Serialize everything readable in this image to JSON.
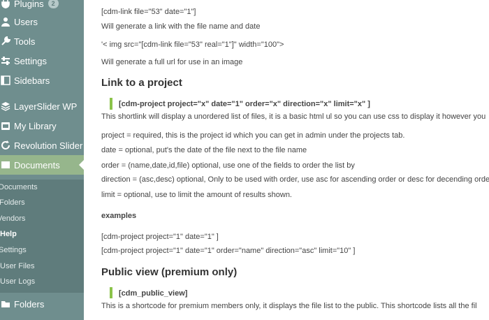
{
  "sidebar": {
    "menu": [
      {
        "label": "Plugins",
        "badge": "2",
        "icon": "plugin-icon"
      },
      {
        "label": "Users",
        "icon": "user-icon"
      },
      {
        "label": "Tools",
        "icon": "wrench-icon"
      },
      {
        "label": "Settings",
        "icon": "settings-icon"
      },
      {
        "label": "Sidebars",
        "icon": "sidebar-icon"
      },
      {
        "label": "LayerSlider WP",
        "icon": "layers-icon"
      },
      {
        "label": "My Library",
        "icon": "library-icon"
      },
      {
        "label": "Revolution Slider",
        "icon": "refresh-icon"
      },
      {
        "label": "Documents",
        "icon": "documents-icon"
      },
      {
        "label": "Folders",
        "icon": "folder-icon"
      }
    ],
    "submenu": [
      "Documents",
      "Folders",
      "Vendors",
      "Help",
      "Settings",
      "User Files",
      "User Logs"
    ],
    "colors": {
      "bg": "#6f8e8e",
      "active": "#96b68c",
      "submenu_bg": "#5f7c7c",
      "accent": "#8bc34a"
    }
  },
  "content": {
    "line1": "[cdm-link file=\"53\" date=\"1\"]",
    "line2": "Will generate a link with the file name and date",
    "line3": "'< img src=\"[cdm-link file=\"53\" real=\"1\"]\" width=\"100\">",
    "line4": "Will generate a full url for use in an image",
    "heading1": "Link to a project",
    "code1": "[cdm-project project=\"x\" date=\"1\" order=\"x\" direction=\"x\" limit=\"x\" ]",
    "desc1": "This shortlink will display a unordered list of files, it is a basic html ul so you can use css to display it however you",
    "param1": "project = required, this is the project id which you can get in admin under the projects tab.",
    "param2": "date = optional, put's the date of the file next to the file name",
    "param3": "order = (name,date,id,file) optional, use one of the fields to order the list by",
    "param4": "direction = (asc,desc) optional, Only to be used with order, use asc for ascending order or desc for decending orde",
    "param5": "limit = optional, use to limit the amount of results shown.",
    "examples_label": "examples",
    "example1": "[cdm-project project=\"1\" date=\"1\" ]",
    "example2": "[cdm-project project=\"1\" date=\"1\" order=\"name\" direction=\"asc\" limit=\"10\" ]",
    "heading2": "Public view (premium only)",
    "code2": "[cdm_public_view]",
    "desc2": "This is a shortcode for premium members only, it displays the file list to the public. This shortcode lists all the fil"
  }
}
